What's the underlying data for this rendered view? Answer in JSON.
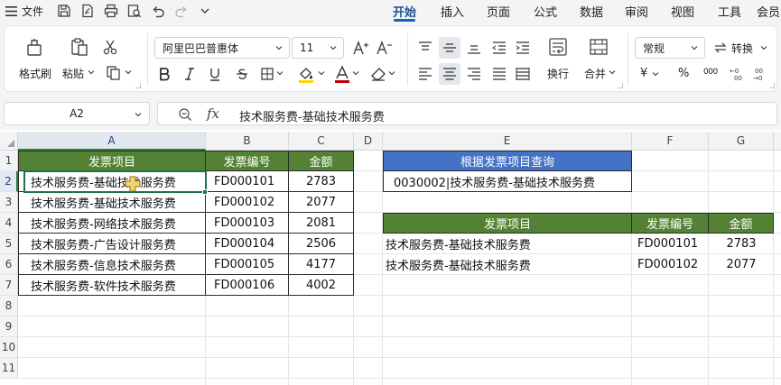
{
  "menubar": {
    "file_label": "文件",
    "tabs": [
      "开始",
      "插入",
      "页面",
      "公式",
      "数据",
      "审阅",
      "视图",
      "工具",
      "会员"
    ],
    "active_tab": "开始"
  },
  "ribbon": {
    "format_painter": "格式刷",
    "paste": "粘贴",
    "font_name": "阿里巴巴普惠体",
    "font_size": "11",
    "wrap": "换行",
    "merge": "合并",
    "number_format": "常规",
    "convert": "转换",
    "currency_symbol": "¥",
    "percent_symbol": "%",
    "thousands_symbol": "000"
  },
  "formula_bar": {
    "cell_ref": "A2",
    "fx": "fx",
    "content": "技术服务费-基础技术服务费"
  },
  "colors": {
    "header_green": "#548235",
    "header_blue": "#4472c4",
    "selection": "#217346",
    "accent_tab": "#1a5fb4"
  },
  "sheet": {
    "columns": [
      "A",
      "B",
      "C",
      "D",
      "E",
      "F",
      "G"
    ],
    "rows": [
      "1",
      "2",
      "3",
      "4",
      "5",
      "6",
      "7",
      "8",
      "9",
      "10",
      "11"
    ],
    "source_table": {
      "headers": [
        "发票项目",
        "发票编号",
        "金额"
      ],
      "rows": [
        [
          "技术服务费-基础技术服务费",
          "FD000101",
          "2783"
        ],
        [
          "技术服务费-基础技术服务费",
          "FD000102",
          "2077"
        ],
        [
          "技术服务费-网络技术服务费",
          "FD000103",
          "2081"
        ],
        [
          "技术服务费-广告设计服务费",
          "FD000104",
          "2506"
        ],
        [
          "技术服务费-信息技术服务费",
          "FD000105",
          "4177"
        ],
        [
          "技术服务费-软件技术服务费",
          "FD000106",
          "4002"
        ]
      ]
    },
    "query": {
      "title": "根据发票项目查询",
      "value": "0030002|技术服务费-基础技术服务费"
    },
    "result_table": {
      "headers": [
        "发票项目",
        "发票编号",
        "金额"
      ],
      "rows": [
        [
          "技术服务费-基础技术服务费",
          "FD000101",
          "2783"
        ],
        [
          "技术服务费-基础技术服务费",
          "FD000102",
          "2077"
        ]
      ]
    }
  }
}
